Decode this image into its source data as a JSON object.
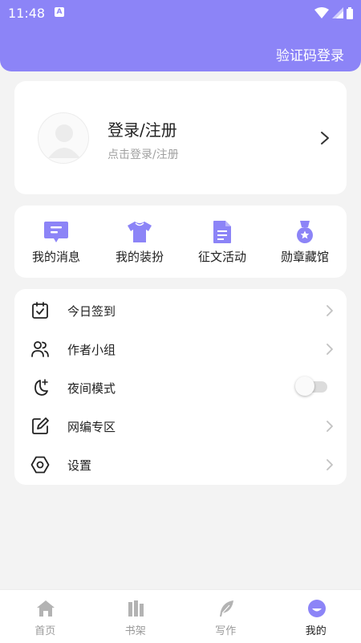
{
  "status_bar": {
    "time": "11:48",
    "notif_glyph": "A"
  },
  "header": {
    "action_label": "验证码登录"
  },
  "profile": {
    "title": "登录/注册",
    "subtitle": "点击登录/注册"
  },
  "quick_actions": [
    {
      "label": "我的消息",
      "icon": "message-icon"
    },
    {
      "label": "我的装扮",
      "icon": "tshirt-icon"
    },
    {
      "label": "征文活动",
      "icon": "document-icon"
    },
    {
      "label": "勋章藏馆",
      "icon": "medal-icon"
    }
  ],
  "menu": [
    {
      "label": "今日签到",
      "icon": "calendar-check-icon"
    },
    {
      "label": "作者小组",
      "icon": "group-icon"
    },
    {
      "label": "夜间模式",
      "icon": "moon-icon",
      "toggle_on": false
    },
    {
      "label": "网编专区",
      "icon": "edit-icon"
    },
    {
      "label": "设置",
      "icon": "settings-icon"
    }
  ],
  "tabs": [
    {
      "label": "首页",
      "icon": "home-icon"
    },
    {
      "label": "书架",
      "icon": "bookshelf-icon"
    },
    {
      "label": "写作",
      "icon": "feather-icon"
    },
    {
      "label": "我的",
      "icon": "profile-icon",
      "active": true
    }
  ],
  "colors": {
    "accent": "#8c84f7",
    "background": "#f3f3f3",
    "card": "#ffffff"
  }
}
